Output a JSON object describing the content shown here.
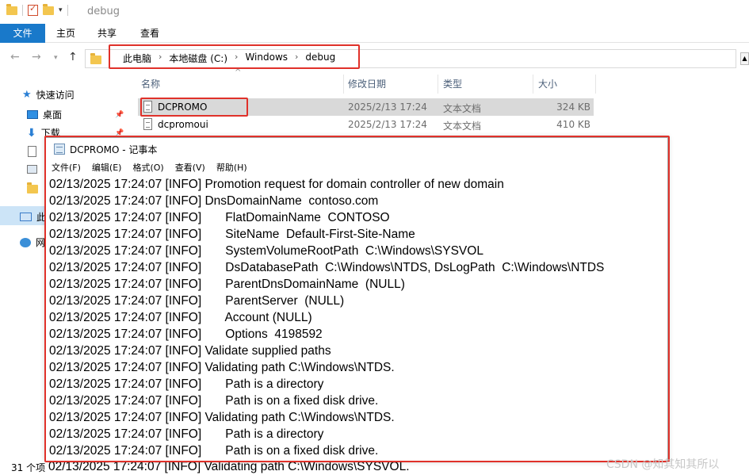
{
  "explorer": {
    "window_title": "debug",
    "ribbon_tabs": [
      "文件",
      "主页",
      "共享",
      "查看"
    ],
    "address": [
      "此电脑",
      "本地磁盘 (C:)",
      "Windows",
      "debug"
    ],
    "columns": [
      "名称",
      "修改日期",
      "类型",
      "大小"
    ],
    "files": [
      {
        "name": "DCPROMO",
        "date": "2025/2/13 17:24",
        "type": "文本文档",
        "size": "324 KB"
      },
      {
        "name": "dcpromoui",
        "date": "2025/2/13 17:24",
        "type": "文本文档",
        "size": "410 KB"
      }
    ],
    "nav": {
      "quick_access": "快速访问",
      "desktop": "桌面",
      "downloads": "下载",
      "this_pc": "此",
      "network": "网"
    },
    "status": "31 个项"
  },
  "notepad": {
    "title": "DCPROMO - 记事本",
    "menu": [
      "文件(F)",
      "编辑(E)",
      "格式(O)",
      "查看(V)",
      "帮助(H)"
    ],
    "lines": [
      "02/13/2025 17:24:07 [INFO] Promotion request for domain controller of new domain",
      "02/13/2025 17:24:07 [INFO] DnsDomainName  contoso.com",
      "02/13/2025 17:24:07 [INFO]       FlatDomainName  CONTOSO",
      "02/13/2025 17:24:07 [INFO]       SiteName  Default-First-Site-Name",
      "02/13/2025 17:24:07 [INFO]       SystemVolumeRootPath  C:\\Windows\\SYSVOL",
      "02/13/2025 17:24:07 [INFO]       DsDatabasePath  C:\\Windows\\NTDS, DsLogPath  C:\\Windows\\NTDS",
      "02/13/2025 17:24:07 [INFO]       ParentDnsDomainName  (NULL)",
      "02/13/2025 17:24:07 [INFO]       ParentServer  (NULL)",
      "02/13/2025 17:24:07 [INFO]       Account (NULL)",
      "02/13/2025 17:24:07 [INFO]       Options  4198592",
      "02/13/2025 17:24:07 [INFO] Validate supplied paths",
      "02/13/2025 17:24:07 [INFO] Validating path C:\\Windows\\NTDS.",
      "02/13/2025 17:24:07 [INFO]       Path is a directory",
      "02/13/2025 17:24:07 [INFO]       Path is on a fixed disk drive.",
      "02/13/2025 17:24:07 [INFO] Validating path C:\\Windows\\NTDS.",
      "02/13/2025 17:24:07 [INFO]       Path is a directory",
      "02/13/2025 17:24:07 [INFO]       Path is on a fixed disk drive."
    ],
    "below_line": "02/13/2025 17:24:07 [INFO] Validating path C:\\Windows\\SYSVOL."
  },
  "watermark": "CSDN @知其知其所以"
}
